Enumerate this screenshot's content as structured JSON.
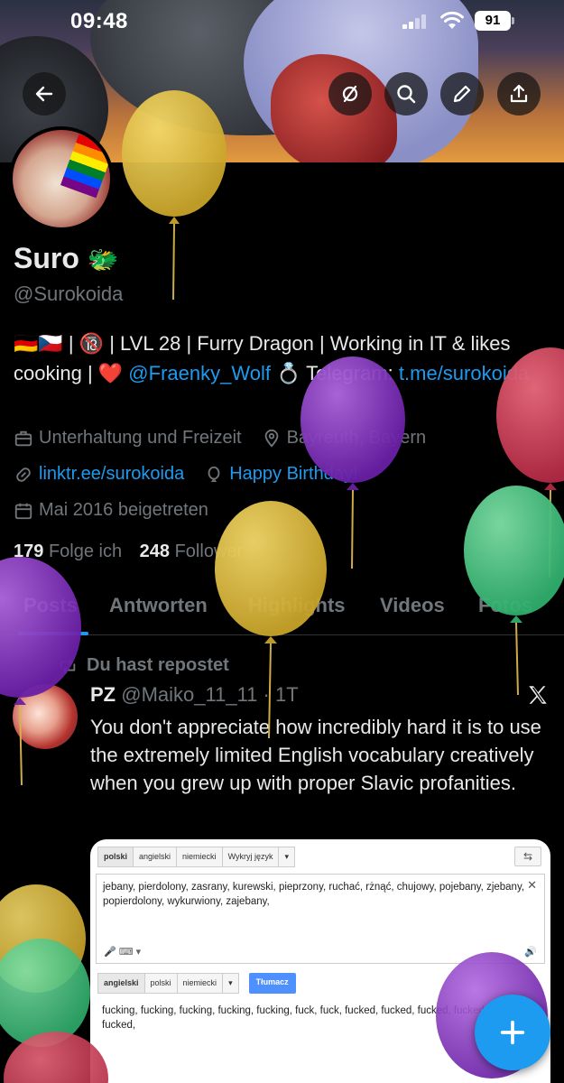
{
  "status_bar": {
    "time": "09:48",
    "battery": "91"
  },
  "profile": {
    "name": "Suro",
    "name_emoji": "🐲",
    "handle": "@Surokoida",
    "bio": {
      "part1": "🇩🇪🇨🇿 | 🔞 | LVL 28 | Furry Dragon | Working in IT & likes cooking | ❤️",
      "mention": "@Fraenky_Wolf",
      "part2": "💍 Telegram:",
      "link": "t.me/surokoida"
    },
    "category": "Unterhaltung und Freizeit",
    "location": "Bayreuth, Bayern",
    "website": "linktr.ee/surokoida",
    "birthday": "Happy Birthday!",
    "joined": "Mai 2016 beigetreten",
    "following_count": "179",
    "following_label": "Folge ich",
    "followers_count": "248",
    "followers_label": "Follower"
  },
  "tabs": [
    "Posts",
    "Antworten",
    "Highlights",
    "Videos",
    "Fotos"
  ],
  "tweet": {
    "repost_label": "Du hast repostet",
    "author_name": "PZ",
    "author_handle": "@Maiko_11_11",
    "time": "1T",
    "text": "You don't appreciate how incredibly hard it is to use the extremely limited English vocabulary creatively when you grew up with proper Slavic profanities.",
    "media": {
      "source_tabs": [
        "polski",
        "angielski",
        "niemiecki",
        "Wykryj język"
      ],
      "source_text": "jebany, pierdolony, zasrany, kurewski, pieprzony, ruchać, rżnąć, chujowy, pojebany, zjebany, popierdolony, wykurwiony, zajebany,",
      "target_tabs": [
        "angielski",
        "polski",
        "niemiecki"
      ],
      "translate_button": "Tłumacz",
      "target_text": "fucking, fucking, fucking, fucking, fucking, fuck, fuck, fucked, fucked, fucked, fucked up, fucked,"
    }
  },
  "colors": {
    "accent": "#1d9bf0",
    "muted": "#71767b",
    "text": "#e7e9ea",
    "background": "#000000"
  },
  "icons": [
    "back-arrow-icon",
    "mute-icon",
    "search-icon",
    "edit-icon",
    "share-icon",
    "briefcase-icon",
    "location-pin-icon",
    "link-icon",
    "balloon-icon",
    "calendar-icon",
    "repost-icon",
    "x-logo-icon",
    "compose-plus-icon"
  ]
}
